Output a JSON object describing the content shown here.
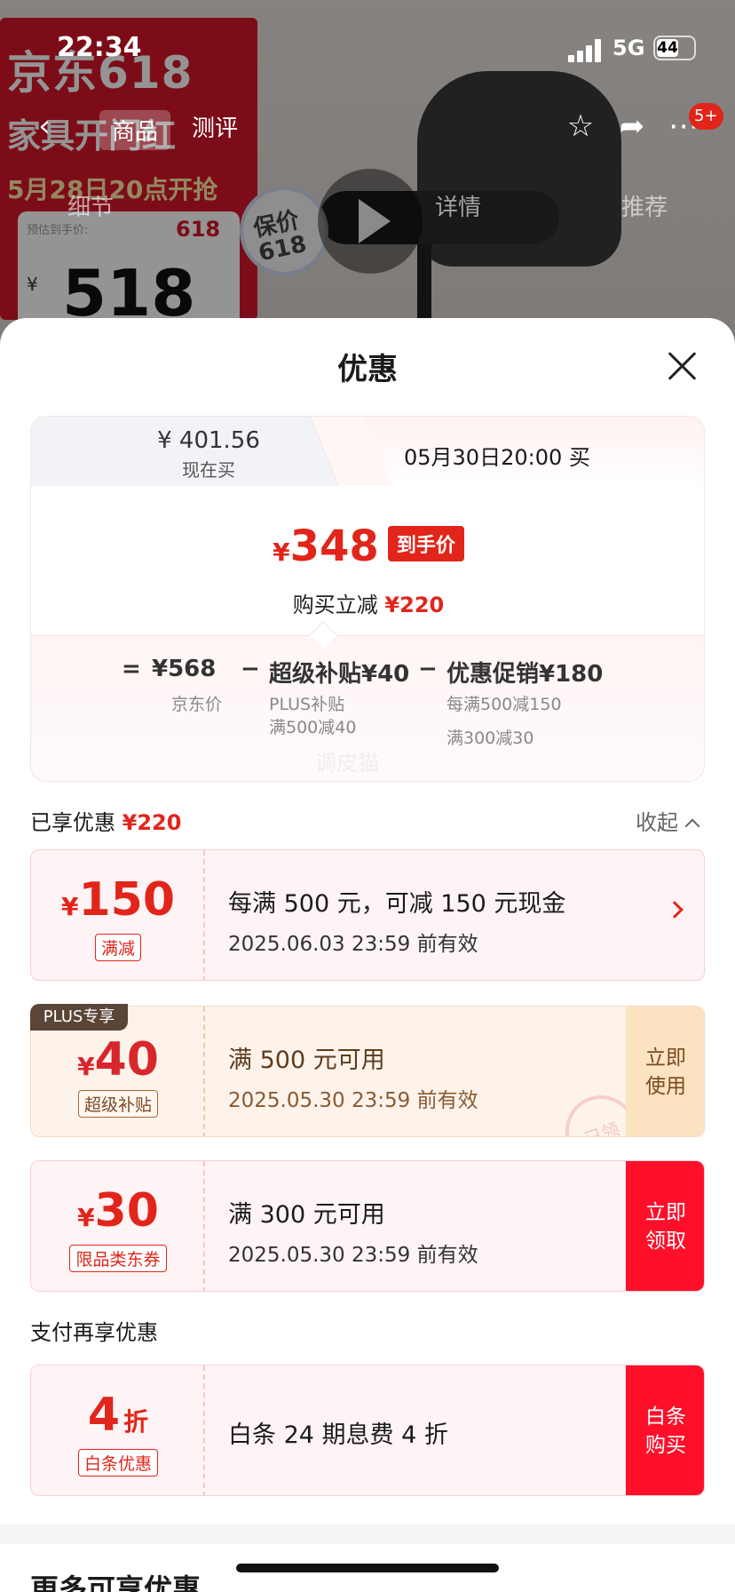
{
  "status_bar": {
    "time": "22:34",
    "network": "5G",
    "battery": "44"
  },
  "background": {
    "promo_title": "京东618",
    "promo_sub": "家具开门红",
    "promo_date": "5月28日20点开抢",
    "card_label": "预估到手价:",
    "card_badge": "618",
    "card_currency": "¥",
    "card_price": "518",
    "badge": "保价618",
    "nav_tabs": [
      "商品",
      "测评"
    ],
    "sub_tabs": [
      "细节",
      "详情",
      "推荐"
    ],
    "cart_count": "5+"
  },
  "sheet": {
    "title": "优惠",
    "tab_now": {
      "amount": "¥ 401.56",
      "label": "现在买"
    },
    "tab_later": {
      "label": "05月30日20:00 买"
    },
    "final": {
      "currency": "¥",
      "price": "348",
      "tag": "到手价",
      "saved_label": "购买立减",
      "saved_value": "¥220"
    },
    "breakdown": {
      "eq": "=",
      "jd_price": "¥568",
      "jd_label": "京东价",
      "minus": "−",
      "subsidy": "超级补贴¥40",
      "subsidy_sub1": "PLUS补贴",
      "subsidy_sub2": "满500减40",
      "promo": "优惠促销¥180",
      "promo_sub1": "每满500减150",
      "promo_sub2": "满300减30",
      "ghost": "调皮猫"
    },
    "enjoyed": {
      "label": "已享优惠",
      "value": "¥220",
      "collapse": "收起"
    },
    "coupons": [
      {
        "currency": "¥",
        "amount": "150",
        "tag": "满减",
        "desc": "每满 500 元，可减 150 元现金",
        "valid": "2025.06.03 23:59 前有效"
      },
      {
        "currency": "¥",
        "amount": "40",
        "tag": "超级补贴",
        "desc": "满 500 元可用",
        "valid": "2025.05.30 23:59 前有效",
        "plus_tag": "PLUS专享",
        "action": "立即使用",
        "stamp": "已领"
      },
      {
        "currency": "¥",
        "amount": "30",
        "tag": "限品类东券",
        "desc": "满 300 元可用",
        "valid": "2025.05.30 23:59 前有效",
        "action": "立即领取"
      }
    ],
    "pay_title": "支付再享优惠",
    "pay": {
      "amount": "4",
      "unit": "折",
      "tag": "白条优惠",
      "desc": "白条 24 期息费 4 折",
      "action": "白条购买"
    },
    "more_title": "更多可享优惠"
  },
  "colors": {
    "accent": "#e1251b",
    "action_red": "#ff0f2a",
    "plus_brown": "#5a4537"
  }
}
